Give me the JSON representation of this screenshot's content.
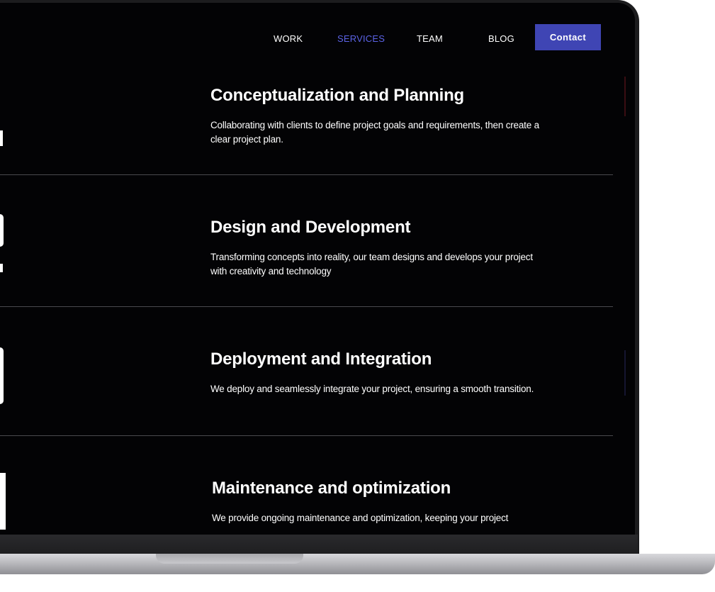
{
  "nav": {
    "items": [
      {
        "label": "WORK",
        "active": false
      },
      {
        "label": "SERVICES",
        "active": true
      },
      {
        "label": "TEAM",
        "active": false
      },
      {
        "label": "BLOG",
        "active": false
      }
    ],
    "contact_label": "Contact"
  },
  "steps": [
    {
      "title": "Conceptualization and Planning",
      "description": "Collaborating with clients to define project goals and requirements, then create a clear project plan."
    },
    {
      "title": "Design and Development",
      "description": "Transforming concepts into reality, our team designs and develops your project with creativity and technology"
    },
    {
      "title": "Deployment and Integration",
      "description": "We deploy and seamlessly integrate your project, ensuring a smooth transition."
    },
    {
      "title": "Maintenance and optimization",
      "description": "We provide ongoing maintenance and optimization, keeping your project"
    }
  ],
  "colors": {
    "background": "#030305",
    "accent": "#3f45b4",
    "active_nav": "#5b63e6",
    "text": "#ffffff",
    "divider": "#4a4a4e"
  }
}
